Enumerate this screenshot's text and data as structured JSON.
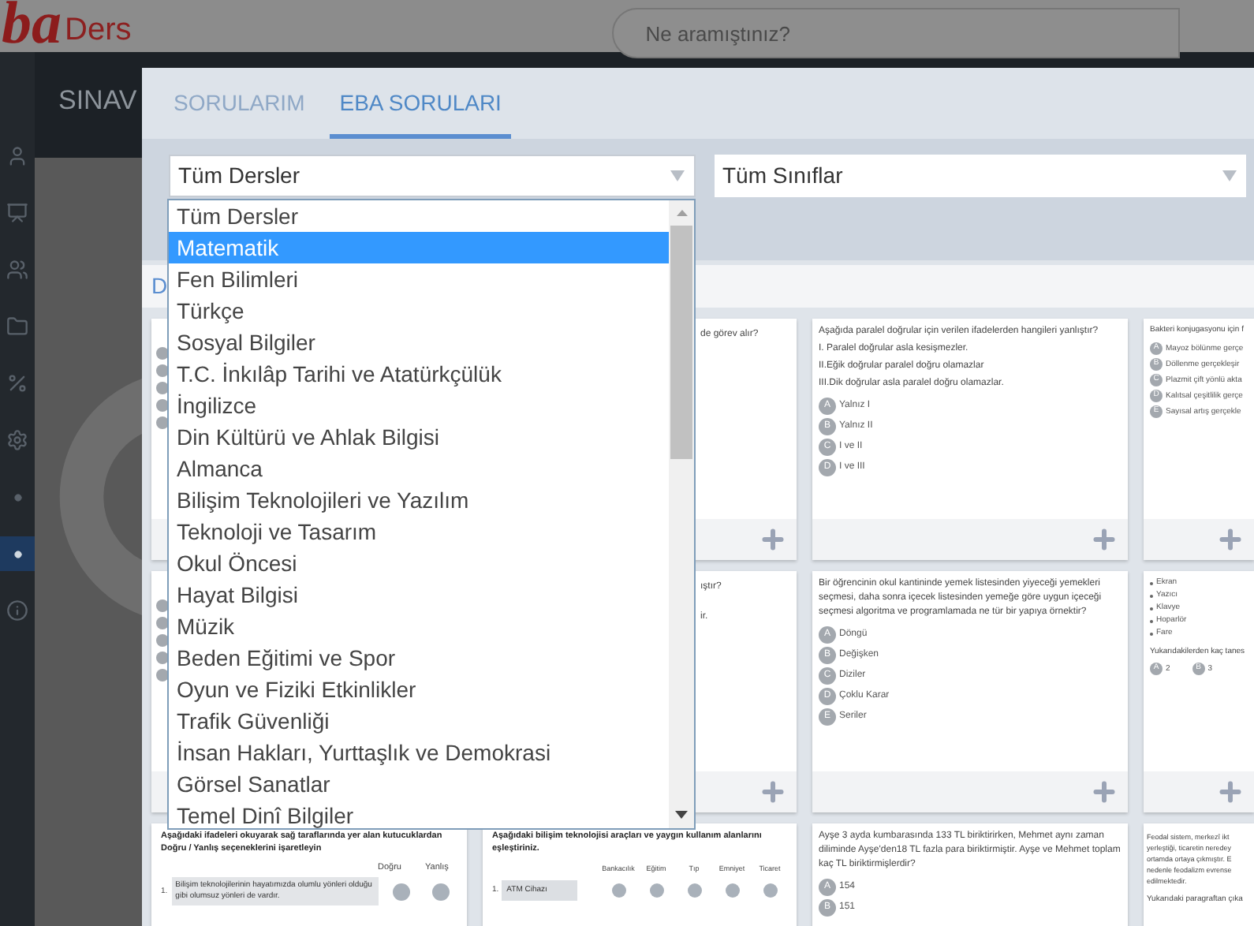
{
  "header": {
    "logo": "ba",
    "logo_suffix": "Ders",
    "search": {
      "placeholder": "Ne aramıştınız?"
    }
  },
  "page_title": "SINAV",
  "sidebar": {
    "items": [
      {
        "kind": "user",
        "selected": false
      },
      {
        "kind": "presentation",
        "selected": false
      },
      {
        "kind": "group",
        "selected": false
      },
      {
        "kind": "folder",
        "selected": false
      },
      {
        "kind": "percent",
        "selected": false
      },
      {
        "kind": "gears",
        "selected": false
      },
      {
        "kind": "dot",
        "selected": false
      },
      {
        "kind": "dot",
        "selected": true
      },
      {
        "kind": "info",
        "selected": false
      }
    ]
  },
  "modal": {
    "tabs": [
      {
        "label": "SORULARIM",
        "selected": false
      },
      {
        "label": "EBA SORULARI",
        "selected": true
      }
    ],
    "filters": [
      {
        "value": "Tüm Dersler",
        "expanded": true
      },
      {
        "value": "Tüm Sınıflar",
        "expanded": false
      }
    ],
    "dropdown": {
      "options": [
        {
          "label": "Tüm Dersler",
          "selected": false
        },
        {
          "label": "Matematik",
          "selected": true
        },
        {
          "label": "Fen Bilimleri",
          "selected": false
        },
        {
          "label": "Türkçe",
          "selected": false
        },
        {
          "label": "Sosyal Bilgiler",
          "selected": false
        },
        {
          "label": "T.C. İnkılâp Tarihi ve Atatürkçülük",
          "selected": false
        },
        {
          "label": "İngilizce",
          "selected": false
        },
        {
          "label": "Din Kültürü ve Ahlak Bilgisi",
          "selected": false
        },
        {
          "label": "Almanca",
          "selected": false
        },
        {
          "label": "Bilişim Teknolojileri ve Yazılım",
          "selected": false
        },
        {
          "label": "Teknoloji ve Tasarım",
          "selected": false
        },
        {
          "label": "Okul Öncesi",
          "selected": false
        },
        {
          "label": "Hayat Bilgisi",
          "selected": false
        },
        {
          "label": "Müzik",
          "selected": false
        },
        {
          "label": "Beden Eğitimi ve Spor",
          "selected": false
        },
        {
          "label": "Oyun ve Fiziki Etkinlikler",
          "selected": false
        },
        {
          "label": "Trafik Güvenliği",
          "selected": false
        },
        {
          "label": "İnsan Hakları, Yurttaşlık ve Demokrasi",
          "selected": false
        },
        {
          "label": "Görsel Sanatlar",
          "selected": false
        },
        {
          "label": "Temel Dinî Bilgiler",
          "selected": false
        }
      ]
    },
    "strip_label": "D",
    "cards": [
      {
        "kind": "hidden",
        "footer": true
      },
      {
        "kind": "fragment",
        "footer": true,
        "lines": [
          "de görev alır?"
        ]
      },
      {
        "kind": "choice",
        "footer": true,
        "lines": [
          "Aşağıda paralel doğrular için verilen ifadelerden hangileri yanlıştır?",
          "I. Paralel doğrular asla kesişmezler.",
          "II.Eğik doğrular paralel doğru olamazlar",
          "III.Dik doğrular asla paralel doğru olamazlar."
        ],
        "options": [
          {
            "letter": "A",
            "text": "Yalnız I"
          },
          {
            "letter": "B",
            "text": "Yalnız II"
          },
          {
            "letter": "C",
            "text": "I ve II"
          },
          {
            "letter": "D",
            "text": "I ve III"
          }
        ]
      },
      {
        "kind": "choice",
        "footer": true,
        "lines": [
          "Bakteri konjugasyonu için f"
        ],
        "options": [
          {
            "letter": "A",
            "text": "Mayoz bölünme gerçe"
          },
          {
            "letter": "B",
            "text": "Döllenme gerçekleşir"
          },
          {
            "letter": "C",
            "text": "Plazmit çift yönlü akta"
          },
          {
            "letter": "D",
            "text": "Kalıtsal çeşitlilik gerçe"
          },
          {
            "letter": "E",
            "text": "Sayısal artış gerçekle"
          }
        ]
      },
      {
        "kind": "hidden",
        "footer": true
      },
      {
        "kind": "fragment",
        "footer": true,
        "lines": [
          "ıştır?",
          "ir."
        ]
      },
      {
        "kind": "choice",
        "footer": true,
        "lines": [
          "Bir öğrencinin okul kantininde yemek listesinden yiyeceği yemekleri seçmesi, daha sonra içecek listesinden yemeğe göre uygun içeceği seçmesi algoritma ve programlamada ne tür bir yapıya örnektir?"
        ],
        "options": [
          {
            "letter": "A",
            "text": "Döngü"
          },
          {
            "letter": "B",
            "text": "Değişken"
          },
          {
            "letter": "C",
            "text": "Diziler"
          },
          {
            "letter": "D",
            "text": "Çoklu Karar"
          },
          {
            "letter": "E",
            "text": "Seriler"
          }
        ]
      },
      {
        "kind": "bullets",
        "footer": true,
        "items": [
          "Ekran",
          "Yazıcı",
          "Klavye",
          "Hoparlör",
          "Fare"
        ],
        "lines": [
          "Yukarıdakilerden kaç tanes"
        ],
        "options": [
          {
            "letter": "A",
            "text": "2"
          },
          {
            "letter": "B",
            "text": "3"
          }
        ]
      },
      {
        "kind": "truefalse",
        "footer": false,
        "lines": [
          "Aşağıdaki ifadeleri okuyarak sağ taraflarında yer alan kutucuklardan Doğru / Yanlış seçeneklerini işaretleyin"
        ],
        "columns": [
          "Doğru",
          "Yanlış"
        ],
        "rows": [
          {
            "number": "1.",
            "text": "Bilişim teknolojilerinin hayatımızda olumlu yönleri olduğu gibi olumsuz yönleri de vardır.",
            "answers": [
              {
                "checked": false
              },
              {
                "checked": false
              }
            ]
          }
        ]
      },
      {
        "kind": "match",
        "footer": false,
        "lines": [
          "Aşağıdaki bilişim teknolojisi araçları ve yaygın kullanım alanlarını eşleştiriniz."
        ],
        "columns": [
          "Bankacılık",
          "Eğitim",
          "Tıp",
          "Emniyet",
          "Ticaret"
        ],
        "rows": [
          {
            "number": "1.",
            "text": "ATM Cihazı",
            "answers": [
              {
                "checked": false
              },
              {
                "checked": false
              },
              {
                "checked": false
              },
              {
                "checked": false
              },
              {
                "checked": false
              }
            ]
          }
        ]
      },
      {
        "kind": "choice",
        "footer": false,
        "lines": [
          "Ayşe 3 ayda kumbarasında 133 TL biriktirirken, Mehmet aynı zaman diliminde Ayşe'den18 TL fazla para biriktirmiştir. Ayşe ve Mehmet toplam kaç TL biriktirmişlerdir?"
        ],
        "options": [
          {
            "letter": "A",
            "text": "154"
          },
          {
            "letter": "B",
            "text": "151"
          }
        ]
      },
      {
        "kind": "paragraph",
        "footer": false,
        "lines": [
          "Feodal sistem, merkezî ikt",
          "yerleştiği, ticaretin neredey",
          "ortamda ortaya çıkmıştır. E",
          "nedenle feodalizm evrense",
          "edilmektedir."
        ],
        "tail": "Yukarıdaki paragraftan çıka"
      }
    ]
  }
}
